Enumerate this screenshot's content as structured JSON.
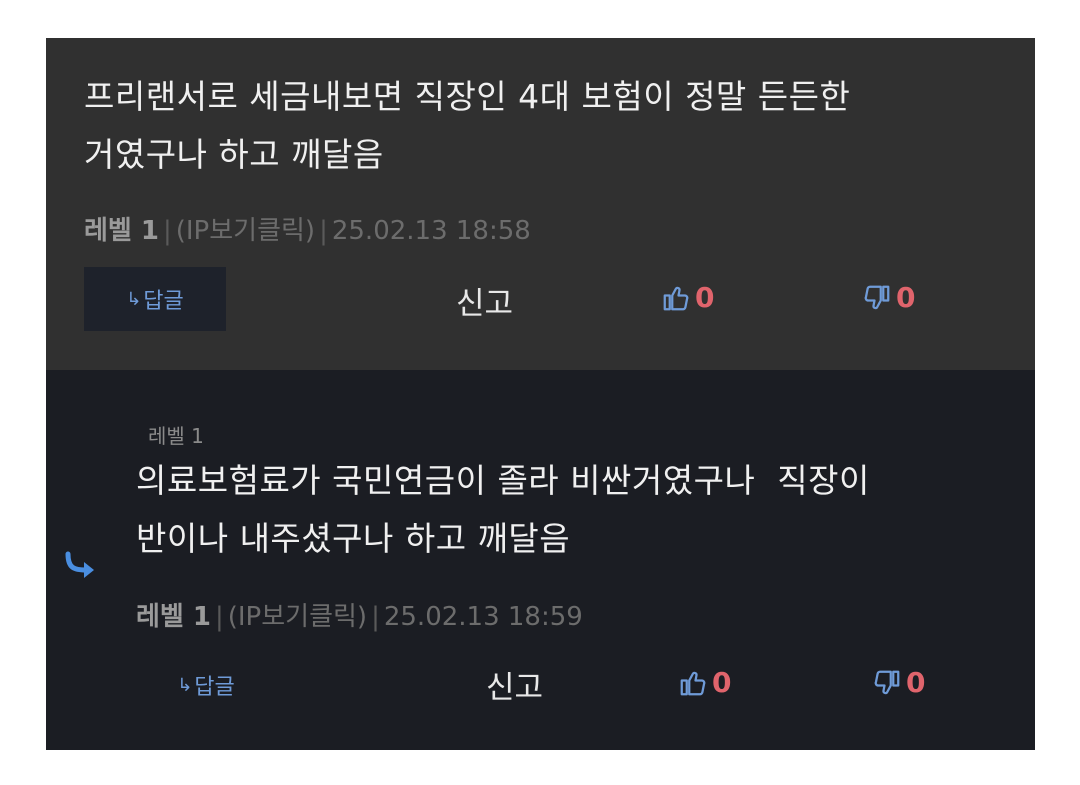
{
  "comment": {
    "text": "프리랜서로 세금내보면 직장인 4대 보험이 정말 든든한\n거였구나 하고 깨달음",
    "level": "레벨 1",
    "ip": "(IP보기클릭)",
    "timestamp": "25.02.13 18:58",
    "reply_label": "답글",
    "report_label": "신고",
    "likes": "0",
    "dislikes": "0"
  },
  "reply": {
    "level_small": "레벨 1",
    "text": "의료보험료가 국민연금이 졸라 비싼거였구나  직장이\n반이나 내주셨구나 하고 깨달음",
    "level": "레벨 1",
    "ip": "(IP보기클릭)",
    "timestamp": "25.02.13 18:59",
    "reply_label": "답글",
    "report_label": "신고",
    "likes": "0",
    "dislikes": "0"
  },
  "colors": {
    "accent": "#6f9bd8",
    "count": "#e0646c"
  },
  "icons": {
    "reply": "reply-arrow-icon",
    "like": "thumbs-up-icon",
    "dislike": "thumbs-down-icon"
  }
}
